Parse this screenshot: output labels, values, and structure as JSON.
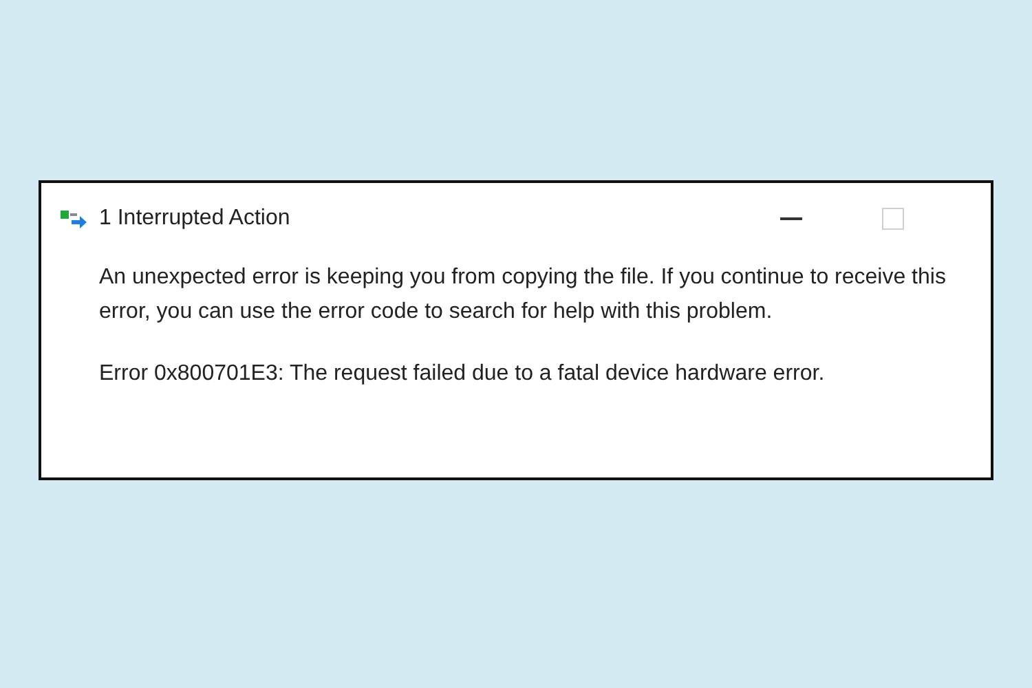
{
  "window": {
    "title": "1 Interrupted Action",
    "maximize_disabled": true
  },
  "message": "An unexpected error is keeping you from copying the file. If you continue to receive this error, you can use the error code to search for help with this problem.",
  "error": "Error 0x800701E3: The request failed due to a fatal device hardware error."
}
